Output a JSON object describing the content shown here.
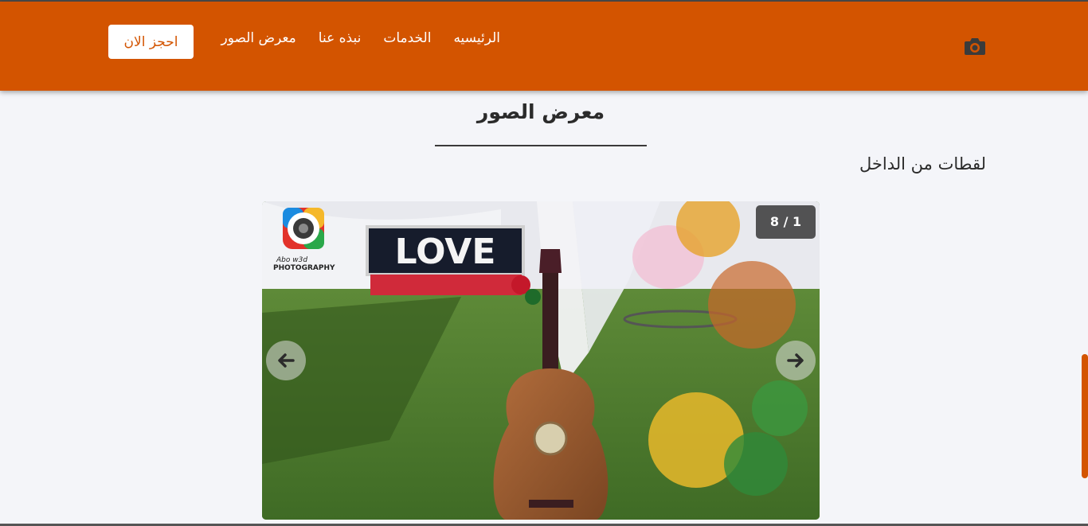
{
  "navbar": {
    "brand_icon": "camera-icon",
    "links": [
      {
        "label": "الرئيسيه"
      },
      {
        "label": "الخدمات"
      },
      {
        "label": "نبذه عنا"
      },
      {
        "label": "معرض الصور"
      }
    ],
    "cta_label": "احجز الان"
  },
  "gallery": {
    "title": "معرض الصور",
    "subtitle": "لقطات من الداخل",
    "counter": "8 / 1",
    "photo_sign_text": "LOVE",
    "watermark_line1": "Abo w3d",
    "watermark_line2": "PHOTOGRAPHY",
    "prev_icon": "arrow-left-icon",
    "next_icon": "arrow-right-icon"
  },
  "colors": {
    "primary": "#d35400",
    "background": "#f4f5f9",
    "text": "#2b2b2b"
  }
}
